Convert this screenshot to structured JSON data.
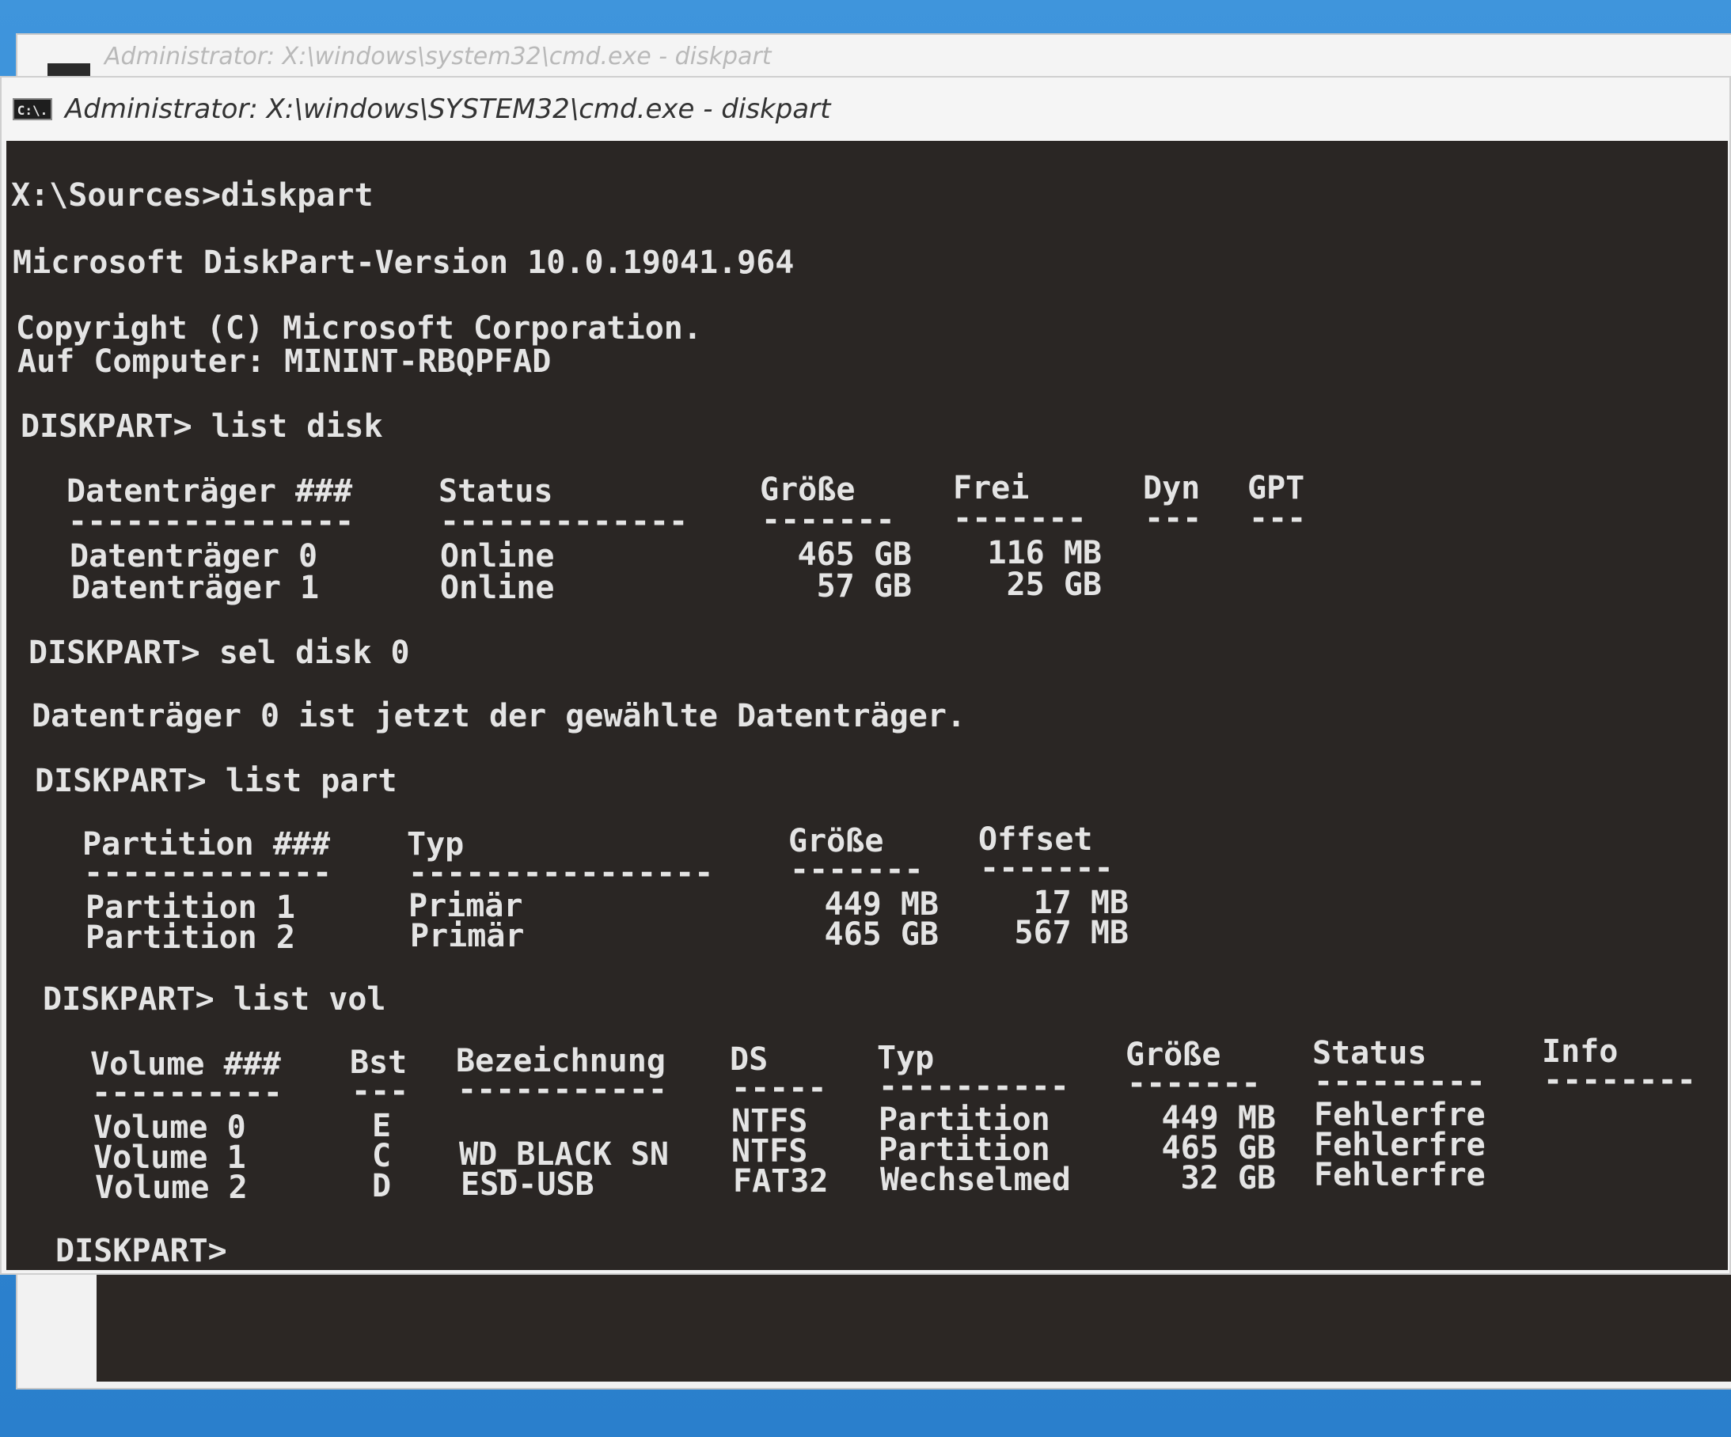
{
  "background_window": {
    "title": "Administrator: X:\\windows\\system32\\cmd.exe - diskpart"
  },
  "window": {
    "icon_label": "C:\\.",
    "title": "Administrator: X:\\windows\\SYSTEM32\\cmd.exe - diskpart"
  },
  "console": {
    "lines": {
      "cmd_diskpart": "X:\\Sources>diskpart",
      "version": "Microsoft DiskPart-Version 10.0.19041.964",
      "copyright": "Copyright (C) Microsoft Corporation.",
      "computer": "Auf Computer: MININT-RBQPFAD",
      "prompt_list_disk": "DISKPART> list disk",
      "prompt_sel_disk": "DISKPART> sel disk 0",
      "sel_result": "Datenträger 0 ist jetzt der gewählte Datenträger.",
      "prompt_list_part": "DISKPART> list part",
      "prompt_list_vol": "DISKPART> list vol",
      "prompt_final": "DISKPART>"
    },
    "disk_table": {
      "headers": [
        "Datenträger ###",
        "Status",
        "Größe",
        "Frei",
        "Dyn",
        "GPT"
      ],
      "separators": [
        "---------------",
        "-------------",
        "-------",
        "-------",
        "---",
        "---"
      ],
      "rows": [
        [
          "Datenträger 0",
          "Online",
          "465 GB",
          "116 MB",
          "",
          ""
        ],
        [
          "Datenträger 1",
          "Online",
          "57 GB",
          "25 GB",
          "",
          ""
        ]
      ]
    },
    "part_table": {
      "headers": [
        "Partition ###",
        "Typ",
        "Größe",
        "Offset"
      ],
      "separators": [
        "-------------",
        "----------------",
        "-------",
        "-------"
      ],
      "rows": [
        [
          "Partition 1",
          "Primär",
          "449 MB",
          "17 MB"
        ],
        [
          "Partition 2",
          "Primär",
          "465 GB",
          "567 MB"
        ]
      ]
    },
    "vol_table": {
      "headers": [
        "Volume ###",
        "Bst",
        "Bezeichnung",
        "DS",
        "Typ",
        "Größe",
        "Status",
        "Info"
      ],
      "separators": [
        "----------",
        "---",
        "-----------",
        "-----",
        "----------",
        "-------",
        "---------",
        "--------"
      ],
      "rows": [
        [
          "Volume 0",
          "E",
          "",
          "NTFS",
          "Partition",
          "449 MB",
          "Fehlerfre",
          ""
        ],
        [
          "Volume 1",
          "C",
          "WD_BLACK SN",
          "NTFS",
          "Partition",
          "465 GB",
          "Fehlerfre",
          ""
        ],
        [
          "Volume 2",
          "D",
          "ESD-USB",
          "FAT32",
          "Wechselmed",
          "32 GB",
          "Fehlerfre",
          ""
        ]
      ]
    }
  },
  "colors": {
    "desktop": "#3a8fd6",
    "console_bg": "#2a2624",
    "console_text": "#e4e4e4"
  }
}
